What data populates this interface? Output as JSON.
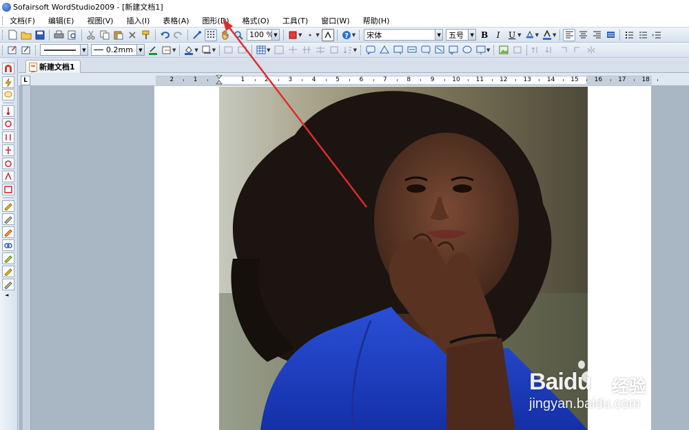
{
  "window": {
    "title": "Sofairsoft WordStudio2009 - [新建文档1]"
  },
  "menu": [
    "文档(F)",
    "编辑(E)",
    "视图(V)",
    "插入(I)",
    "表格(A)",
    "图形(D)",
    "格式(O)",
    "工具(T)",
    "窗口(W)",
    "帮助(H)"
  ],
  "toolbar1": {
    "zoom": "100 %",
    "font_name": "宋体",
    "font_size": "五号",
    "bold_label": "B",
    "italic_label": "I",
    "underline_label": "U"
  },
  "toolbar2": {
    "line_width": "0.2mm"
  },
  "tabs": {
    "document_tab": "新建文档1"
  },
  "ruler": {
    "corner": "L",
    "labels": [
      "2",
      "1",
      "1",
      "2",
      "3",
      "4",
      "5",
      "6",
      "7",
      "8",
      "9",
      "10",
      "11",
      "12",
      "13",
      "14",
      "15",
      "16",
      "17",
      "18"
    ]
  },
  "watermark": {
    "brand": "Bai",
    "brand_suffix": "du",
    "chinese": "经验",
    "url": "jingyan.baidu.com"
  },
  "colors": {
    "annotation_arrow": "#e02b2b",
    "photo_shirt": "#1f3fbf"
  },
  "icons": [
    "new-doc-icon",
    "open-folder-icon",
    "save-icon",
    "print-icon",
    "print-preview-icon",
    "cut-icon",
    "copy-icon",
    "paste-icon",
    "delete-icon",
    "format-painter-icon",
    "undo-icon",
    "redo-icon",
    "insert-image-icon",
    "grid-icon",
    "hand-icon",
    "zoom-icon",
    "help-icon",
    "align-left-icon",
    "align-center-icon",
    "align-right-icon",
    "justify-icon"
  ]
}
